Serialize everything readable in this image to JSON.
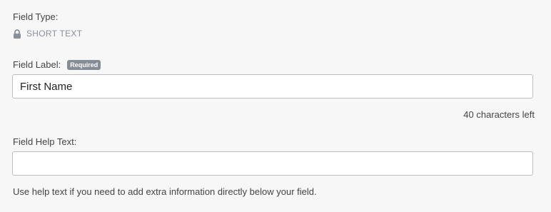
{
  "field_type": {
    "label": "Field Type:",
    "icon": "lock-icon",
    "value": "SHORT TEXT"
  },
  "field_label": {
    "label": "Field Label:",
    "badge": "Required",
    "value": "First Name",
    "counter": "40 characters left"
  },
  "field_help_text": {
    "label": "Field Help Text:",
    "value": "",
    "hint": "Use help text if you need to add extra information directly below your field."
  }
}
